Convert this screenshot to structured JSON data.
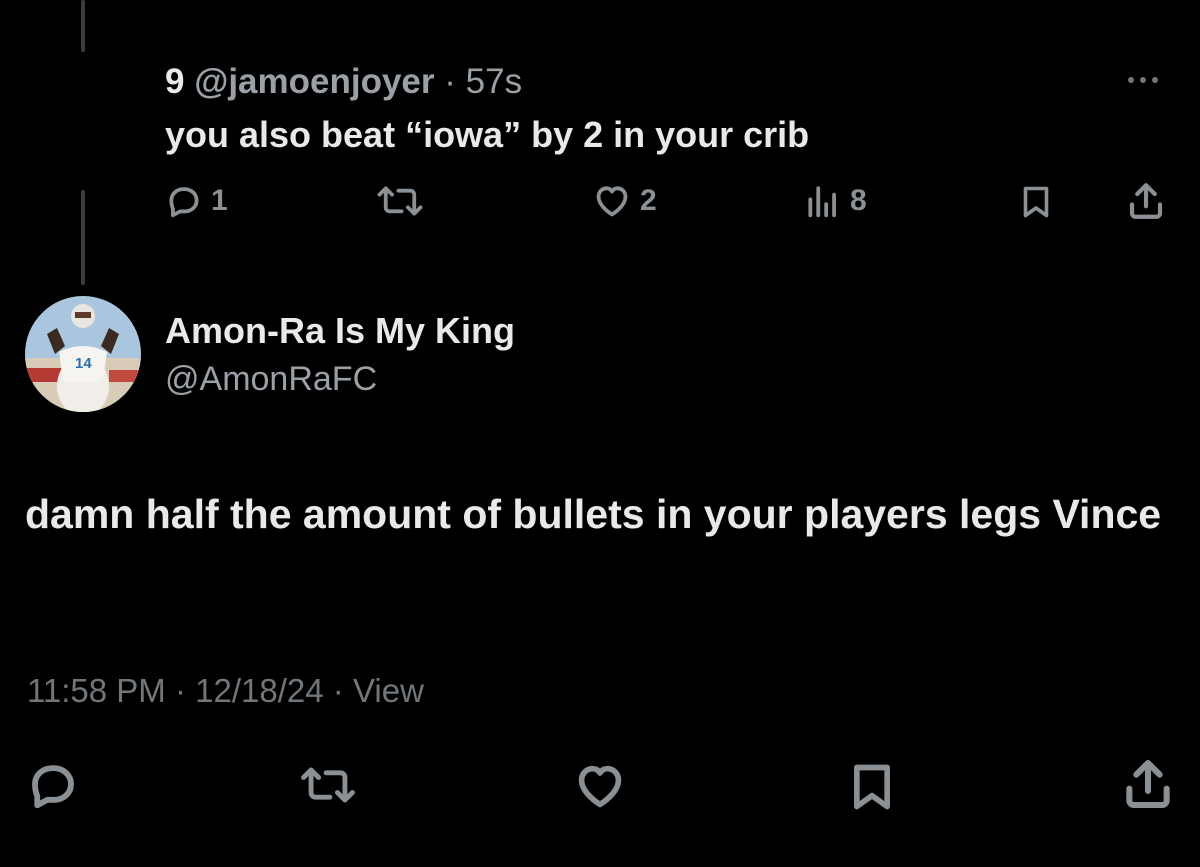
{
  "reply": {
    "number": "9",
    "handle": "@jamoenjoyer",
    "separator": "·",
    "time": "57s",
    "text": "you also beat “iowa” by 2 in your crib",
    "actions": {
      "replies": "1",
      "likes": "2",
      "views": "8"
    }
  },
  "post": {
    "author_name": "Amon-Ra Is My King",
    "author_handle": "@AmonRaFC",
    "text": "damn half the amount of bullets in your players legs Vince",
    "time": "11:58 PM",
    "date": "12/18/24",
    "view_label": "View",
    "separator": "·"
  },
  "icons": {
    "reply": "reply-icon",
    "repost": "repost-icon",
    "like": "heart-icon",
    "views": "views-icon",
    "bookmark": "bookmark-icon",
    "share": "share-icon",
    "more": "more-icon"
  },
  "colors": {
    "background": "#000000",
    "text": "#e7e9ea",
    "secondary": "#71767b",
    "thread_line": "#3a3d40"
  }
}
